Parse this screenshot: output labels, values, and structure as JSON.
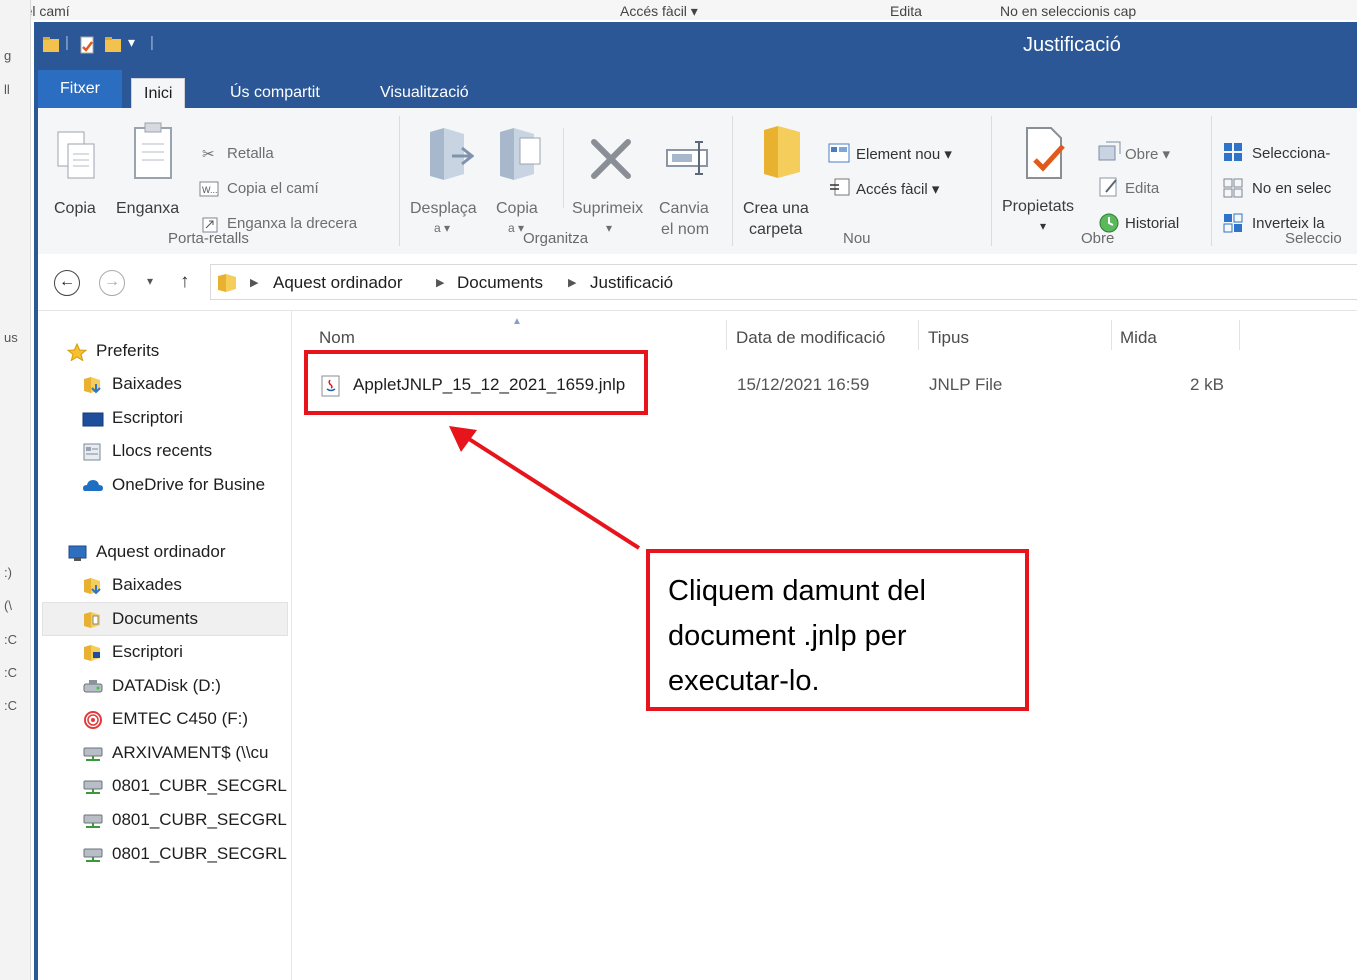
{
  "background_fragments": {
    "top": [
      "pia el camí",
      "Accés fàcil ▾",
      "Edita",
      "No en seleccionis cap"
    ],
    "left": [
      "g",
      "ll",
      "us",
      ":)",
      "(\\",
      ":C",
      ":C",
      ":C"
    ]
  },
  "window": {
    "title": "Justificació"
  },
  "ribbon": {
    "tabs": {
      "file": "Fitxer",
      "home": "Inici",
      "share": "Ús compartit",
      "view": "Visualització"
    },
    "clipboard": {
      "copy": "Copia",
      "paste": "Enganxa",
      "cut": "Retalla",
      "copy_path": "Copia el camí",
      "paste_shortcut": "Enganxa la drecera",
      "label": "Porta-retalls"
    },
    "organize": {
      "move_to_1": "Desplaça",
      "move_to_2": "a ▾",
      "copy_to_1": "Copia",
      "copy_to_2": "a ▾",
      "delete": "Suprimeix",
      "delete_arrow": "▾",
      "rename_1": "Canvia",
      "rename_2": "el nom",
      "label": "Organitza"
    },
    "new": {
      "new_folder_1": "Crea una",
      "new_folder_2": "carpeta",
      "new_item": "Element nou ▾",
      "easy_access": "Accés fàcil ▾",
      "label": "Nou"
    },
    "open": {
      "properties": "Propietats",
      "properties_arrow": "▾",
      "open": "Obre ▾",
      "edit": "Edita",
      "history": "Historial",
      "label": "Obre"
    },
    "select": {
      "select_all": "Selecciona-",
      "select_none": "No en selec",
      "invert": "Inverteix la",
      "label": "Seleccio"
    }
  },
  "address": {
    "back": "←",
    "forward": "→",
    "recent": "▾",
    "up": "↑",
    "crumbs": [
      "Aquest ordinador",
      "Documents",
      "Justificació"
    ]
  },
  "nav": {
    "favorites": "Preferits",
    "fav_items": [
      "Baixades",
      "Escriptori",
      "Llocs recents",
      "OneDrive for Busine"
    ],
    "this_pc": "Aquest ordinador",
    "pc_items": [
      "Baixades",
      "Documents",
      "Escriptori",
      "DATADisk (D:)",
      "EMTEC C450 (F:)",
      "ARXIVAMENT$ (\\\\cu",
      "0801_CUBR_SECGRL",
      "0801_CUBR_SECGRL",
      "0801_CUBR_SECGRL"
    ]
  },
  "columns": {
    "name": "Nom",
    "modified": "Data de modificació",
    "type": "Tipus",
    "size": "Mida"
  },
  "files": [
    {
      "name": "AppletJNLP_15_12_2021_1659.jnlp",
      "modified": "15/12/2021 16:59",
      "type": "JNLP File",
      "size": "2 kB"
    }
  ],
  "annotation": {
    "text": "Cliquem damunt del document .jnlp per executar-lo."
  },
  "colors": {
    "titlebar": "#2b5797",
    "file_tab": "#2b6dc0",
    "annotation_red": "#e8141b",
    "folder": "#f2c14e"
  }
}
